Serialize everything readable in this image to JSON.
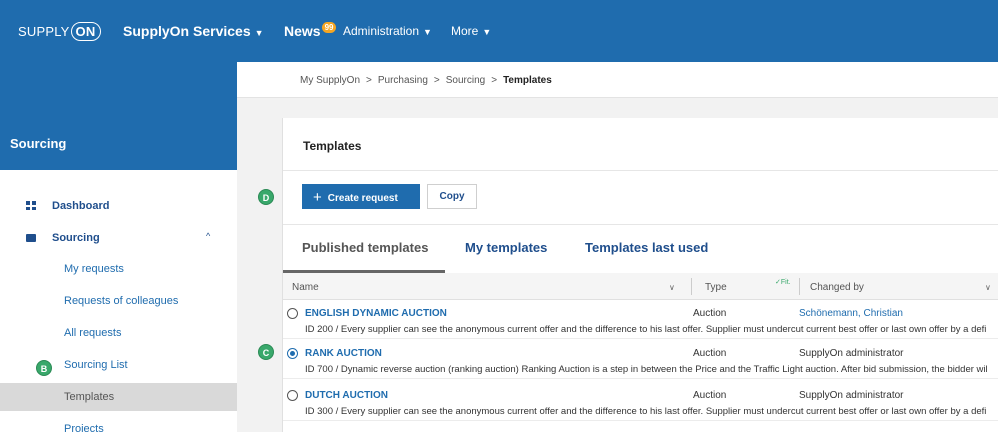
{
  "topbar": {
    "logo_prefix": "SUPPLY",
    "logo_suffix": "ON",
    "services_label": "SupplyOn Services",
    "news_label": "News",
    "news_badge": "99",
    "admin_label": "Administration",
    "more_label": "More",
    "caret": "▼"
  },
  "sidebar": {
    "title": "Sourcing",
    "items": [
      {
        "label": "Dashboard"
      },
      {
        "label": "Sourcing"
      },
      {
        "label": "My requests"
      },
      {
        "label": "Requests of colleagues"
      },
      {
        "label": "All requests"
      },
      {
        "label": "Sourcing List"
      },
      {
        "label": "Templates"
      },
      {
        "label": "Projects"
      }
    ],
    "collapse_chevron": "^"
  },
  "breadcrumb": {
    "items": [
      "My SupplyOn",
      "Purchasing",
      "Sourcing",
      "Templates"
    ],
    "separator": ">"
  },
  "markers": {
    "b": "B",
    "c": "C",
    "d": "D"
  },
  "panel": {
    "title": "Templates",
    "create_label": "Create request",
    "create_icon": "+",
    "copy_label": "Copy"
  },
  "tabs": [
    {
      "label": "Published templates",
      "active": true
    },
    {
      "label": "My templates",
      "active": false
    },
    {
      "label": "Templates last used",
      "active": false
    }
  ],
  "table": {
    "columns": {
      "name": "Name",
      "type": "Type",
      "fit": "✓Fit.",
      "changed_by": "Changed by"
    },
    "rows": [
      {
        "name": "ENGLISH DYNAMIC AUCTION",
        "type": "Auction",
        "changed_by": "Schönemann, Christian",
        "description": "ID 200 / Every supplier can see the anonymous current offer and the difference to his last offer. Supplier must undercut current best offer or last own offer by a defi",
        "selected": false
      },
      {
        "name": "RANK AUCTION",
        "type": "Auction",
        "changed_by": "SupplyOn administrator",
        "description": "ID 700 / Dynamic reverse auction (ranking auction) Ranking Auction is a step in between the Price and the Traffic Light auction. After bid submission, the bidder wil",
        "selected": true
      },
      {
        "name": "DUTCH AUCTION",
        "type": "Auction",
        "changed_by": "SupplyOn administrator",
        "description": "ID 300 / Every supplier can see the anonymous current offer and the difference to his last offer. Supplier must undercut current best offer or last own offer by a defi",
        "selected": false
      }
    ]
  },
  "colors": {
    "brand_blue": "#1f6cae",
    "marker_green": "#39a86b"
  }
}
